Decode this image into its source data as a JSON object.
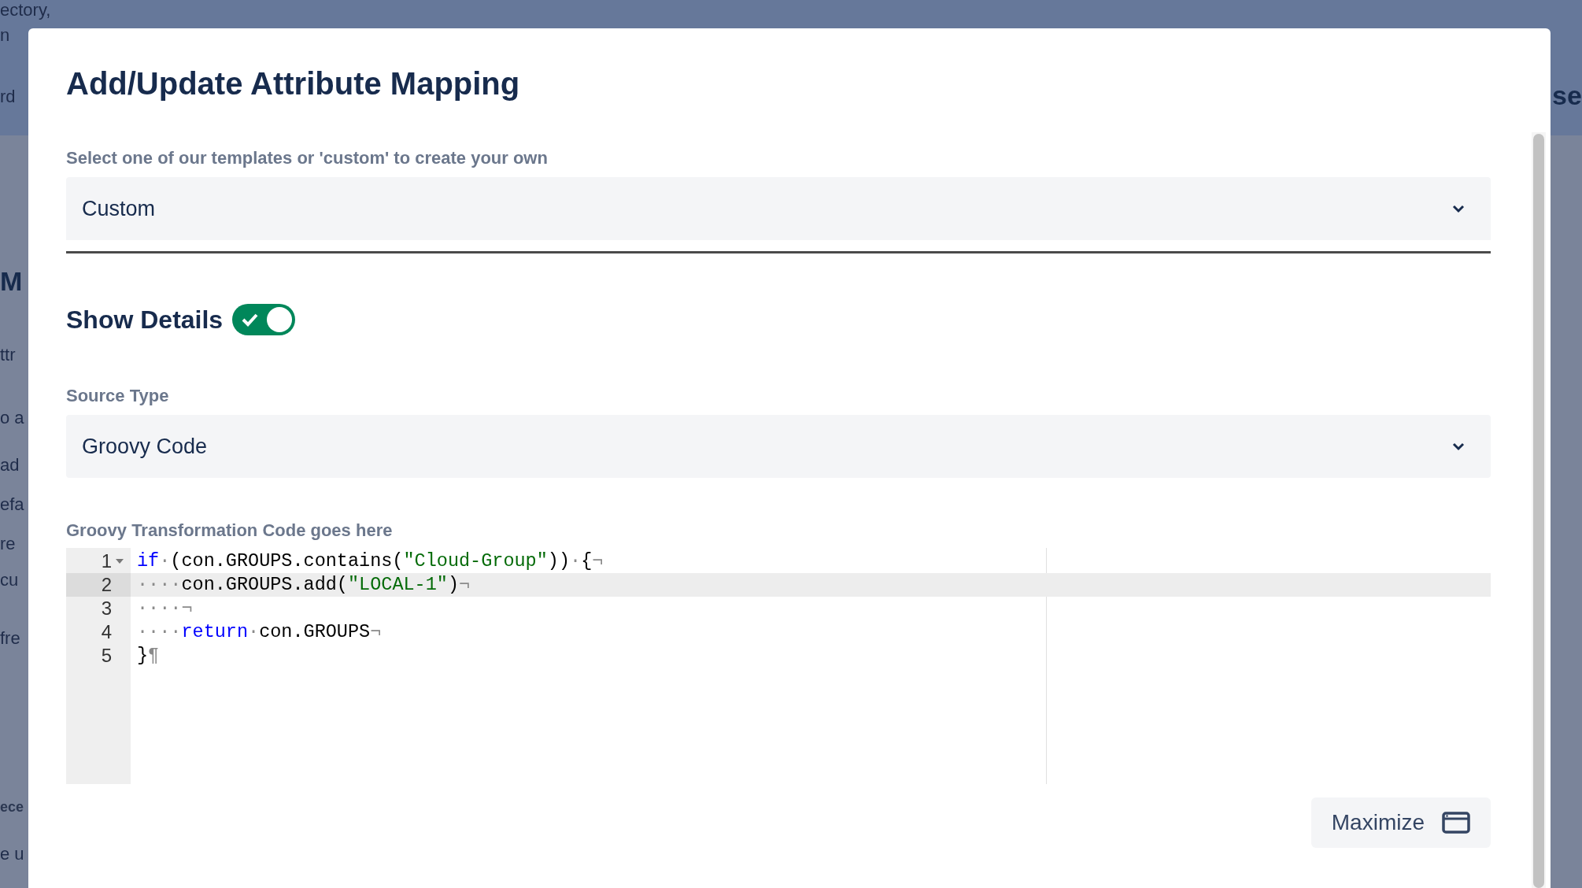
{
  "background": {
    "left_fragments": [
      {
        "text": "ectory,",
        "kind": "plain"
      },
      {
        "text": "n",
        "kind": "plain"
      },
      {
        "text": "rd",
        "kind": "plain"
      },
      {
        "text": "M",
        "kind": "heading"
      },
      {
        "text": "ttr",
        "kind": "plain"
      },
      {
        "text": "o a",
        "kind": "plain"
      },
      {
        "text": "ad",
        "kind": "plain"
      },
      {
        "text": "efa",
        "kind": "plain"
      },
      {
        "text": "re",
        "kind": "plain"
      },
      {
        "text": "cu",
        "kind": "plain"
      },
      {
        "text": "fre",
        "kind": "plain"
      },
      {
        "text": "ece",
        "kind": "small"
      },
      {
        "text": "e u",
        "kind": "plain"
      }
    ],
    "right_fragments": [
      {
        "text": "se",
        "kind": "heading"
      }
    ]
  },
  "dialog": {
    "title": "Add/Update Attribute Mapping",
    "template": {
      "label": "Select one of our templates or 'custom' to create your own",
      "value": "Custom"
    },
    "show_details": {
      "label": "Show Details",
      "on": true
    },
    "source_type": {
      "label": "Source Type",
      "value": "Groovy Code"
    },
    "code_editor": {
      "label": "Groovy Transformation Code goes here",
      "lines": [
        {
          "number": "1",
          "foldable": true,
          "active": false,
          "tokens": [
            {
              "kind": "keyword",
              "text": "if"
            },
            {
              "kind": "invisible",
              "text": "·"
            },
            {
              "kind": "plain",
              "text": "(con.GROUPS.contains("
            },
            {
              "kind": "string",
              "text": "\"Cloud-Group\""
            },
            {
              "kind": "plain",
              "text": "))"
            },
            {
              "kind": "invisible",
              "text": "·"
            },
            {
              "kind": "plain",
              "text": "{"
            },
            {
              "kind": "invisible",
              "text": "¬"
            }
          ]
        },
        {
          "number": "2",
          "foldable": false,
          "active": true,
          "tokens": [
            {
              "kind": "invisible",
              "text": "····"
            },
            {
              "kind": "plain",
              "text": "con.GROUPS.add("
            },
            {
              "kind": "string",
              "text": "\"LOCAL-1\""
            },
            {
              "kind": "plain",
              "text": ")"
            },
            {
              "kind": "invisible",
              "text": "¬"
            }
          ]
        },
        {
          "number": "3",
          "foldable": false,
          "active": false,
          "tokens": [
            {
              "kind": "invisible",
              "text": "····¬"
            }
          ]
        },
        {
          "number": "4",
          "foldable": false,
          "active": false,
          "tokens": [
            {
              "kind": "invisible",
              "text": "····"
            },
            {
              "kind": "keyword",
              "text": "return"
            },
            {
              "kind": "invisible",
              "text": "·"
            },
            {
              "kind": "plain",
              "text": "con.GROUPS"
            },
            {
              "kind": "invisible",
              "text": "¬"
            }
          ]
        },
        {
          "number": "5",
          "foldable": false,
          "active": false,
          "tokens": [
            {
              "kind": "plain",
              "text": "}"
            },
            {
              "kind": "invisible",
              "text": "¶"
            }
          ]
        }
      ]
    },
    "maximize_button": "Maximize"
  }
}
